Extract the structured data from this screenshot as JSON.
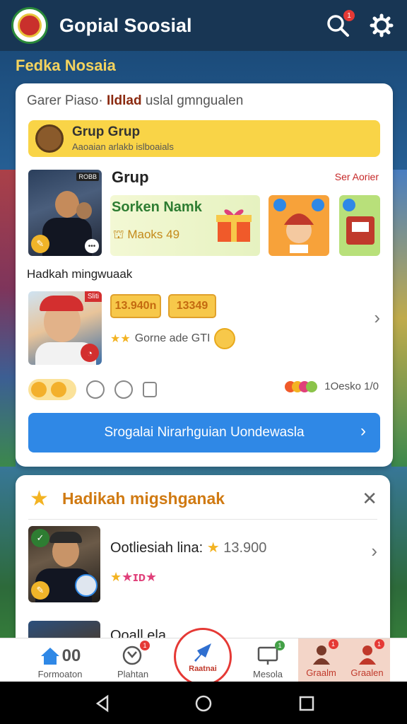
{
  "app": {
    "title": "Gopial Soosial",
    "notification_count": "1"
  },
  "section": {
    "title": "Fedka Nosaia"
  },
  "card1": {
    "header_prefix": "Garer Piaso·",
    "header_bold": "Ildlad",
    "header_suffix": "uslal gmngualen",
    "banner": {
      "title": "Grup Grup",
      "subtitle": "Aaoaian arlakb islboaials"
    },
    "photo1_badge": "ROBB",
    "group_label": "Grup",
    "see_more": "Ser Aorier",
    "promo": {
      "title": "Sorken Namk",
      "subtitle": "Maoks 49"
    },
    "row_label": "Hadkah mingwuaak",
    "photo2_badge": "Sliti",
    "pills": [
      "13.940n",
      "13349"
    ],
    "stars_text": "Gorne ade GTI",
    "stats_text": "1Oesko 1/0",
    "cta_label": "Srogalai Nirarhguian Uondewasla"
  },
  "card2": {
    "title": "Hadikah migshganak",
    "item1": {
      "prefix": "Ootliesiah lina:",
      "value": "13.900"
    },
    "item2": {
      "prefix": "Ooall ela"
    }
  },
  "bottom_nav": {
    "items": [
      {
        "label": "Formoaton",
        "icon": "home-icon",
        "extra": "00"
      },
      {
        "label": "Plahtan",
        "icon": "chart-icon",
        "badge": "1"
      },
      {
        "label": "Raatnai",
        "icon": "rocket-icon"
      },
      {
        "label": "Mesola",
        "icon": "monitor-icon",
        "badge": "1"
      },
      {
        "label": "Graalm",
        "icon": "profile-icon",
        "badge": "1"
      },
      {
        "label": "Graalen",
        "icon": "user-icon",
        "badge": "1"
      }
    ]
  },
  "colors": {
    "appbar": "#183654",
    "accent_yellow": "#f9d447",
    "cta_blue": "#2f88e6",
    "accent_red": "#e53935"
  }
}
